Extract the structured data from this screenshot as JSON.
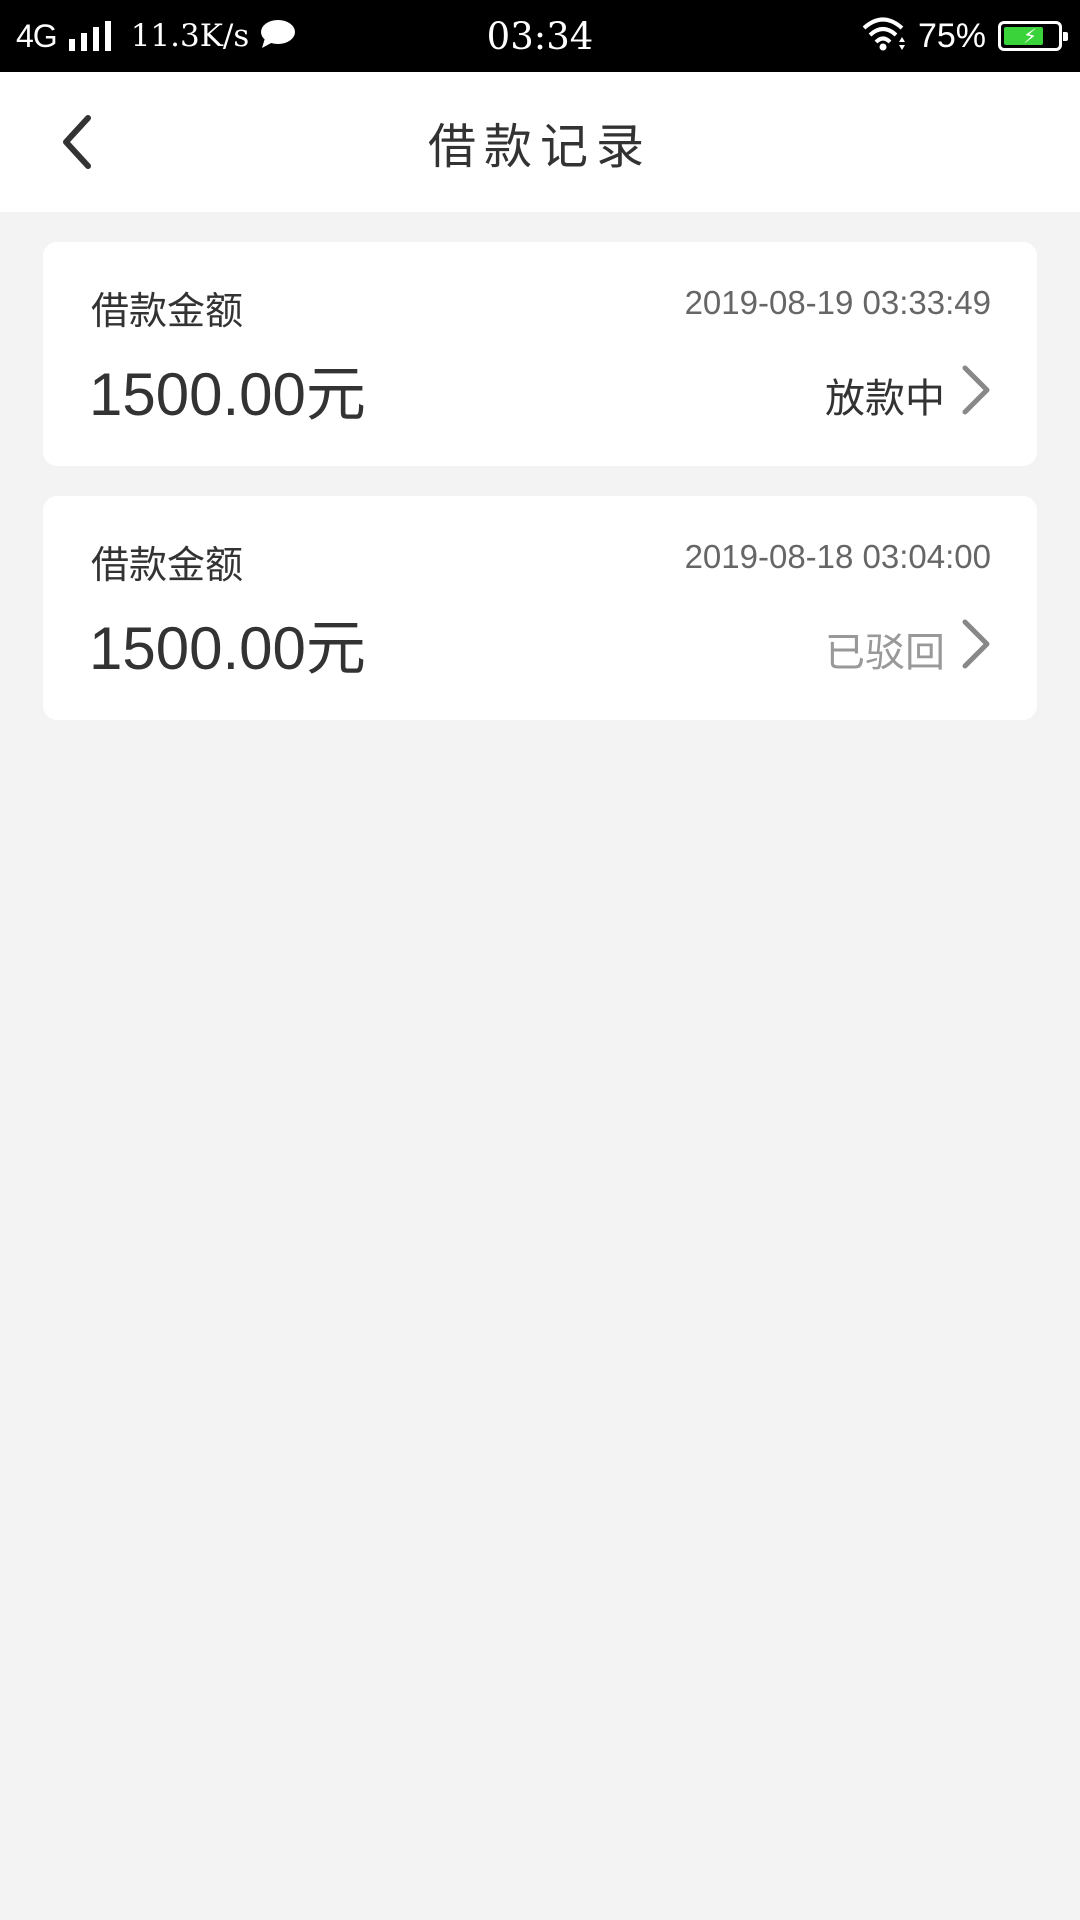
{
  "status_bar": {
    "network": "4G",
    "speed": "11.3K/s",
    "time": "03:34",
    "battery": "75%",
    "battery_level": 0.75
  },
  "header": {
    "title": "借款记录"
  },
  "records": [
    {
      "label": "借款金额",
      "date": "2019-08-19 03:33:49",
      "amount": "1500.00元",
      "status": "放款中",
      "status_color": "#333333"
    },
    {
      "label": "借款金额",
      "date": "2019-08-18 03:04:00",
      "amount": "1500.00元",
      "status": "已驳回",
      "status_color": "#999999"
    }
  ]
}
